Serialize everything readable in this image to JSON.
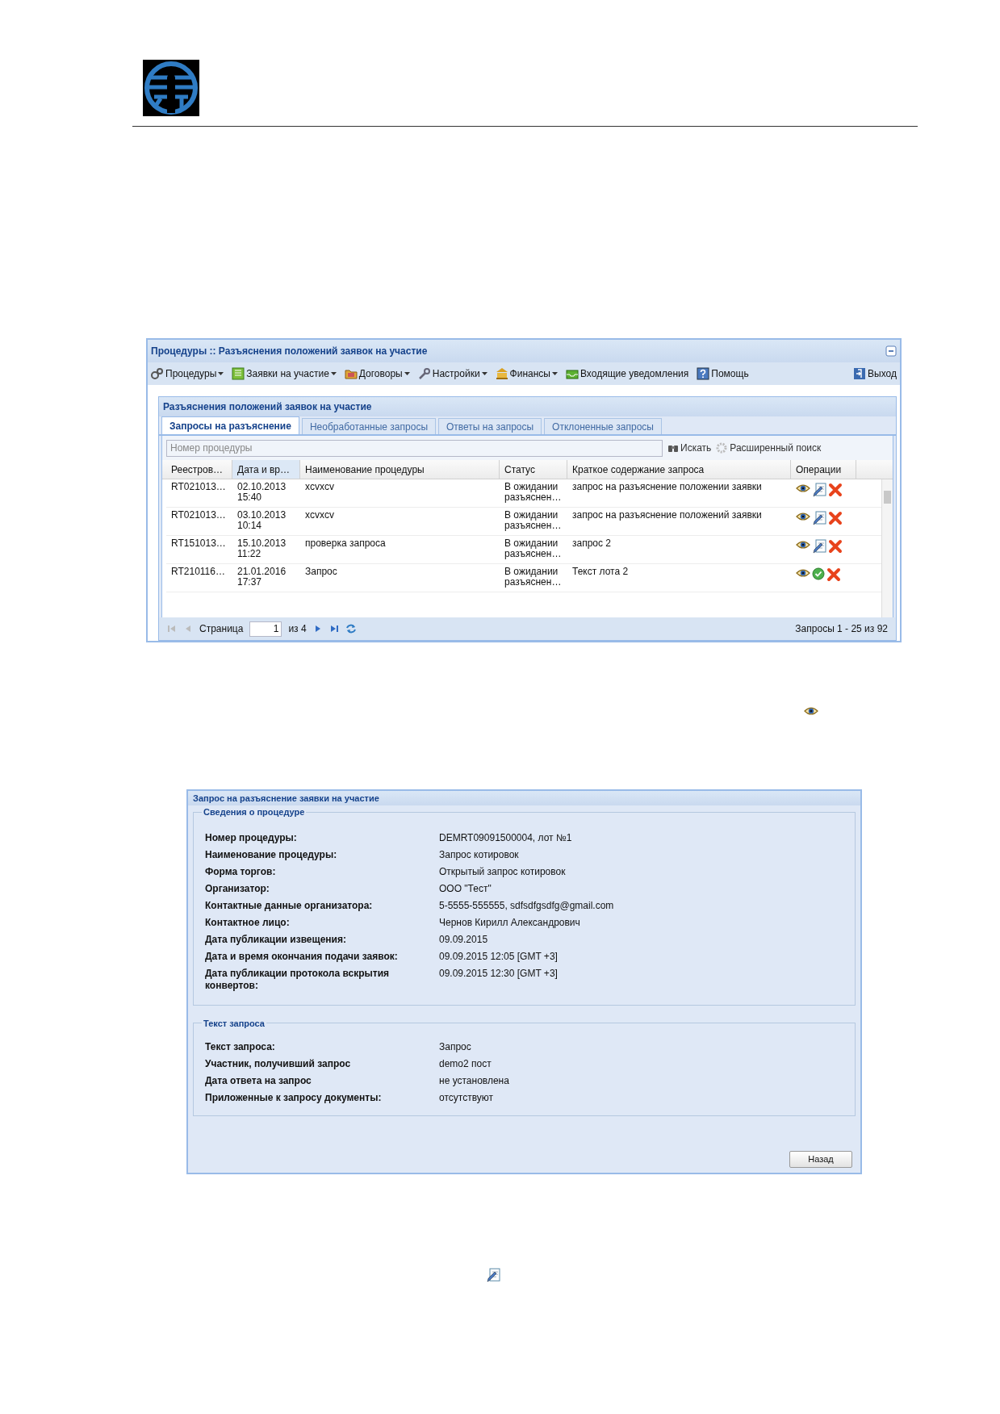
{
  "window": {
    "title": "Процедуры :: Разъяснения положений заявок на участие",
    "menu": [
      {
        "label": "Процедуры",
        "kind": "gears",
        "dropdown": true
      },
      {
        "label": "Заявки на участие",
        "kind": "sheet",
        "dropdown": true
      },
      {
        "label": "Договоры",
        "kind": "folder",
        "dropdown": true
      },
      {
        "label": "Настройки",
        "kind": "wrench",
        "dropdown": true
      },
      {
        "label": "Финансы",
        "kind": "bank",
        "dropdown": true
      },
      {
        "label": "Входящие уведомления",
        "kind": "tray",
        "dropdown": false
      },
      {
        "label": "Помощь",
        "kind": "help",
        "dropdown": false
      }
    ],
    "exit": "Выход",
    "panel": {
      "title": "Разъяснения положений заявок на участие",
      "tabs": [
        {
          "label": "Запросы на разъяснение",
          "selected": true
        },
        {
          "label": "Необработанные запросы",
          "selected": false
        },
        {
          "label": "Ответы на запросы",
          "selected": false
        },
        {
          "label": "Отклоненные запросы",
          "selected": false
        }
      ],
      "search": {
        "placeholder": "Номер процедуры",
        "find": "Искать",
        "advanced": "Расширенный поиск"
      },
      "columns": [
        {
          "label": "Реестров…",
          "sorted": false
        },
        {
          "label": "Дата и вр…",
          "sorted": true
        },
        {
          "label": "Наименование процедуры",
          "sorted": false
        },
        {
          "label": "Статус",
          "sorted": false
        },
        {
          "label": "Краткое содержание запроса",
          "sorted": false
        },
        {
          "label": "Операции",
          "sorted": false
        }
      ],
      "rows": [
        {
          "number": "RT021013…",
          "date": "02.10.2013 15:40",
          "name": "xcvxcv",
          "status": "В ожидании разъяснен…",
          "summary": "запрос на разъяснение положении заявки",
          "kind": "edit"
        },
        {
          "number": "RT021013…",
          "date": "03.10.2013 10:14",
          "name": "xcvxcv",
          "status": "В ожидании разъяснен…",
          "summary": "запрос на разъяснение положений заявки",
          "kind": "edit"
        },
        {
          "number": "RT151013…",
          "date": "15.10.2013 11:22",
          "name": "проверка запроса",
          "status": "В ожидании разъяснен…",
          "summary": "запрос 2",
          "kind": "edit"
        },
        {
          "number": "RT210116…",
          "date": "21.01.2016 17:37",
          "name": "Запрос",
          "status": "В ожидании разъяснен…",
          "summary": "Текст лота 2",
          "kind": "approve"
        }
      ],
      "pager": {
        "page_label": "Страница",
        "page": "1",
        "of": "из 4",
        "summary": "Запросы 1 - 25 из 92"
      }
    }
  },
  "dialog": {
    "title": "Запрос на разъяснение заявки на участие",
    "sections": [
      {
        "legend": "Сведения о процедуре",
        "fields": [
          {
            "label": "Номер процедуры:",
            "value": "DEMRT09091500004, лот №1"
          },
          {
            "label": "Наименование процедуры:",
            "value": "Запрос котировок"
          },
          {
            "label": "Форма торгов:",
            "value": "Открытый запрос котировок"
          },
          {
            "label": "Организатор:",
            "value": "ООО \"Тест\""
          },
          {
            "label": "Контактные данные организатора:",
            "value": "5-5555-555555, sdfsdfgsdfg@gmail.com"
          },
          {
            "label": "Контактное лицо:",
            "value": "Чернов Кирилл Александрович"
          },
          {
            "label": "Дата публикации извещения:",
            "value": "09.09.2015"
          },
          {
            "label": "Дата и время окончания подачи заявок:",
            "value": "09.09.2015 12:05 [GMT +3]"
          },
          {
            "label": "Дата публикации протокола вскрытия конвертов:",
            "value": "09.09.2015 12:30 [GMT +3]"
          }
        ]
      },
      {
        "legend": "Текст запроса",
        "fields": [
          {
            "label": "Текст запроса:",
            "value": "Запрос"
          },
          {
            "label": "Участник, получивший запрос",
            "value": "demo2 пост"
          },
          {
            "label": "Дата ответа на запрос",
            "value": "не установлена"
          },
          {
            "label": "Приложенные к запросу документы:",
            "value": "отсутствуют"
          }
        ]
      }
    ],
    "button": "Назад"
  }
}
